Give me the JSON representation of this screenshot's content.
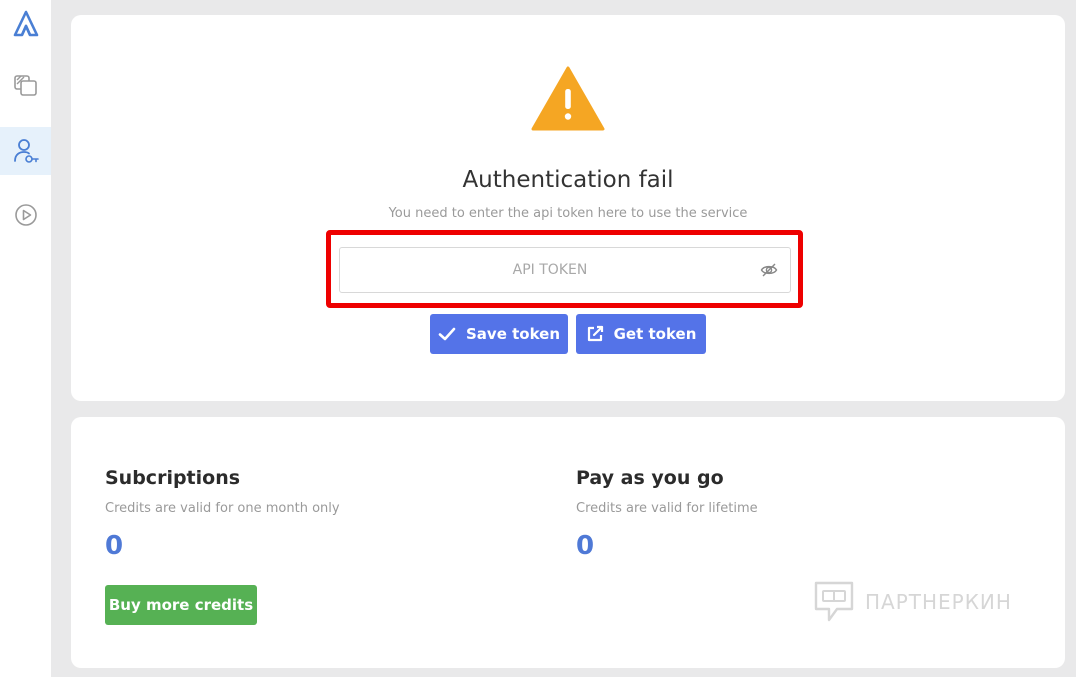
{
  "sidebar": {
    "items": [
      {
        "icon": "app-logo-icon"
      },
      {
        "icon": "collections-icon"
      },
      {
        "icon": "account-key-icon",
        "active": true
      },
      {
        "icon": "play-icon"
      }
    ]
  },
  "auth": {
    "icon": "warning-icon",
    "title": "Authentication fail",
    "subtitle": "You need to enter the api token here to use the service",
    "token_placeholder": "API TOKEN",
    "token_value": "",
    "save_label": "Save token",
    "get_label": "Get token"
  },
  "credits": {
    "subscriptions": {
      "title": "Subcriptions",
      "subtitle": "Credits are valid for one month only",
      "count": "0"
    },
    "payg": {
      "title": "Pay as you go",
      "subtitle": "Credits are valid for lifetime",
      "count": "0"
    },
    "buy_label": "Buy more credits"
  },
  "watermark": {
    "text": "ПАРТНЕРКИН"
  },
  "colors": {
    "accent_blue": "#5473e8",
    "count_blue": "#4f79d6",
    "buy_green": "#56b154",
    "warning_orange": "#f5a623",
    "highlight_red": "#ee0000"
  }
}
